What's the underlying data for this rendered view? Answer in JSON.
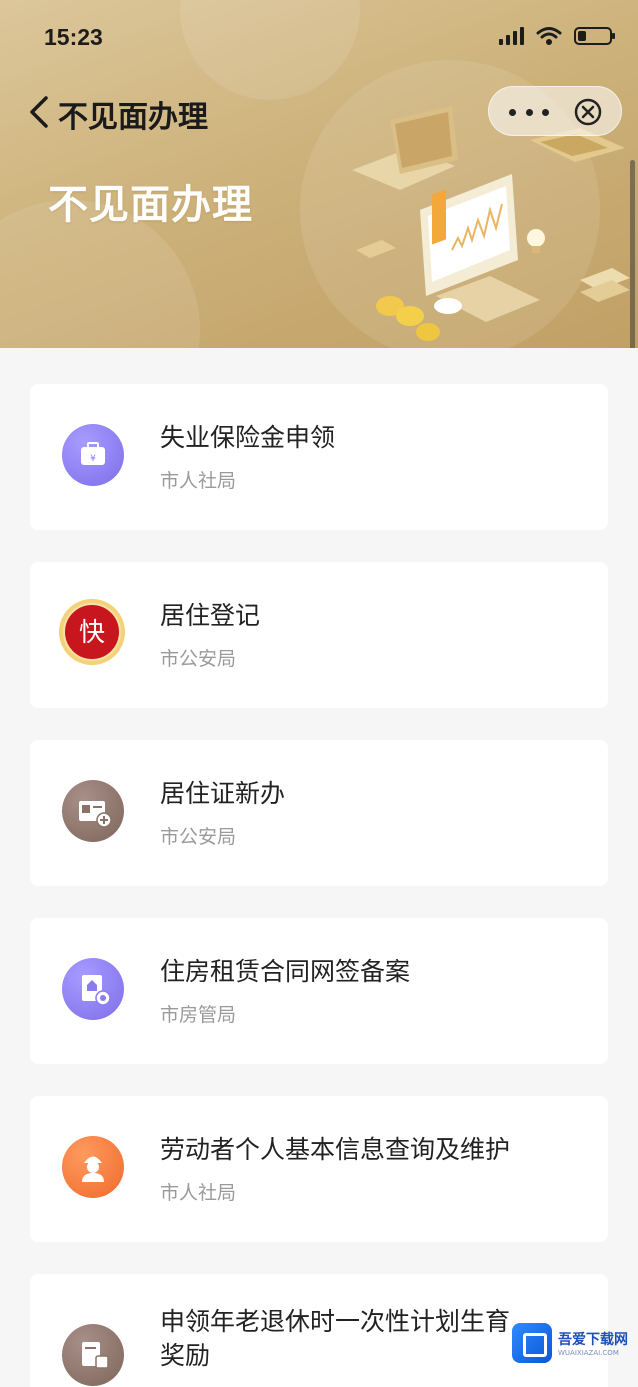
{
  "status_bar": {
    "time": "15:23"
  },
  "nav": {
    "title": "不见面办理"
  },
  "banner": {
    "title": "不见面办理"
  },
  "services": [
    {
      "title": "失业保险金申领",
      "department": "市人社局",
      "icon": "briefcase-icon",
      "color": "#8a7cf0"
    },
    {
      "title": "居住登记",
      "department": "市公安局",
      "icon": "fast-badge-icon",
      "color": "#c8161e",
      "badge": "快"
    },
    {
      "title": "居住证新办",
      "department": "市公安局",
      "icon": "id-card-add-icon",
      "color": "#8b7467"
    },
    {
      "title": "住房租赁合同网签备案",
      "department": "市房管局",
      "icon": "house-contract-icon",
      "color": "#8a7cf0"
    },
    {
      "title": "劳动者个人基本信息查询及维护",
      "department": "市人社局",
      "icon": "worker-icon",
      "color": "#f47a3a"
    },
    {
      "title": "申领年老退休时一次性计划生育",
      "title_line2": "奖励",
      "department": "",
      "icon": "document-icon",
      "color": "#8b7467"
    }
  ],
  "watermark": {
    "name": "吾爱下载网",
    "url": "WUAIXIAZAI.COM"
  }
}
